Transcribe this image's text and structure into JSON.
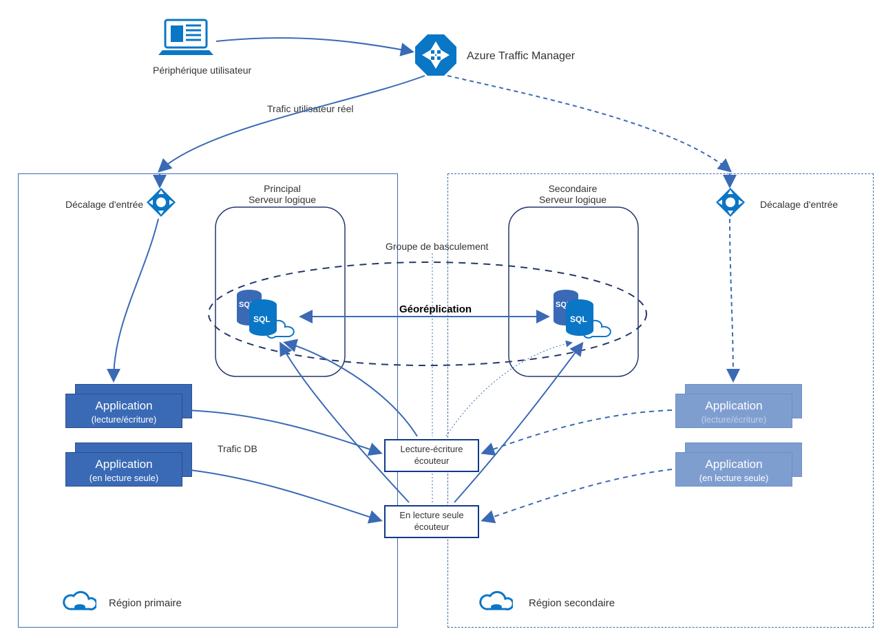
{
  "labels": {
    "device": "Périphérique utilisateur",
    "traffic_manager": "Azure Traffic Manager",
    "real_user_traffic": "Trafic utilisateur réel",
    "entry_offset_left": "Décalage d'entrée",
    "entry_offset_right": "Décalage d'entrée",
    "principal_line1": "Principal",
    "principal_line2": "Serveur logique",
    "secondary_line1": "Secondaire",
    "secondary_line2": "Serveur logique",
    "failover_group": "Groupe de basculement",
    "geo_rep": "Géoréplication",
    "db_traffic": "Trafic DB",
    "app_title": "Application",
    "app_rw_sub": "(lecture/écriture)",
    "app_ro_sub": "(en lecture seule)",
    "app_sec_rw_sub": "(lecture/écriture)",
    "app_sec_ro_sub": "(en lecture seule)",
    "listener_rw_l1": "Lecture-écriture",
    "listener_rw_l2": "écouteur",
    "listener_ro_l1": "En lecture seule",
    "listener_ro_l2": "écouteur",
    "region_primary": "Région primaire",
    "region_secondary": "Région secondaire"
  },
  "colors": {
    "azure_blue": "#0a76c6",
    "box_blue": "#3a6ab5",
    "box_secondary": "#7f9ed0",
    "line_dark": "#13388b",
    "line_blue": "#3a6ab5"
  }
}
